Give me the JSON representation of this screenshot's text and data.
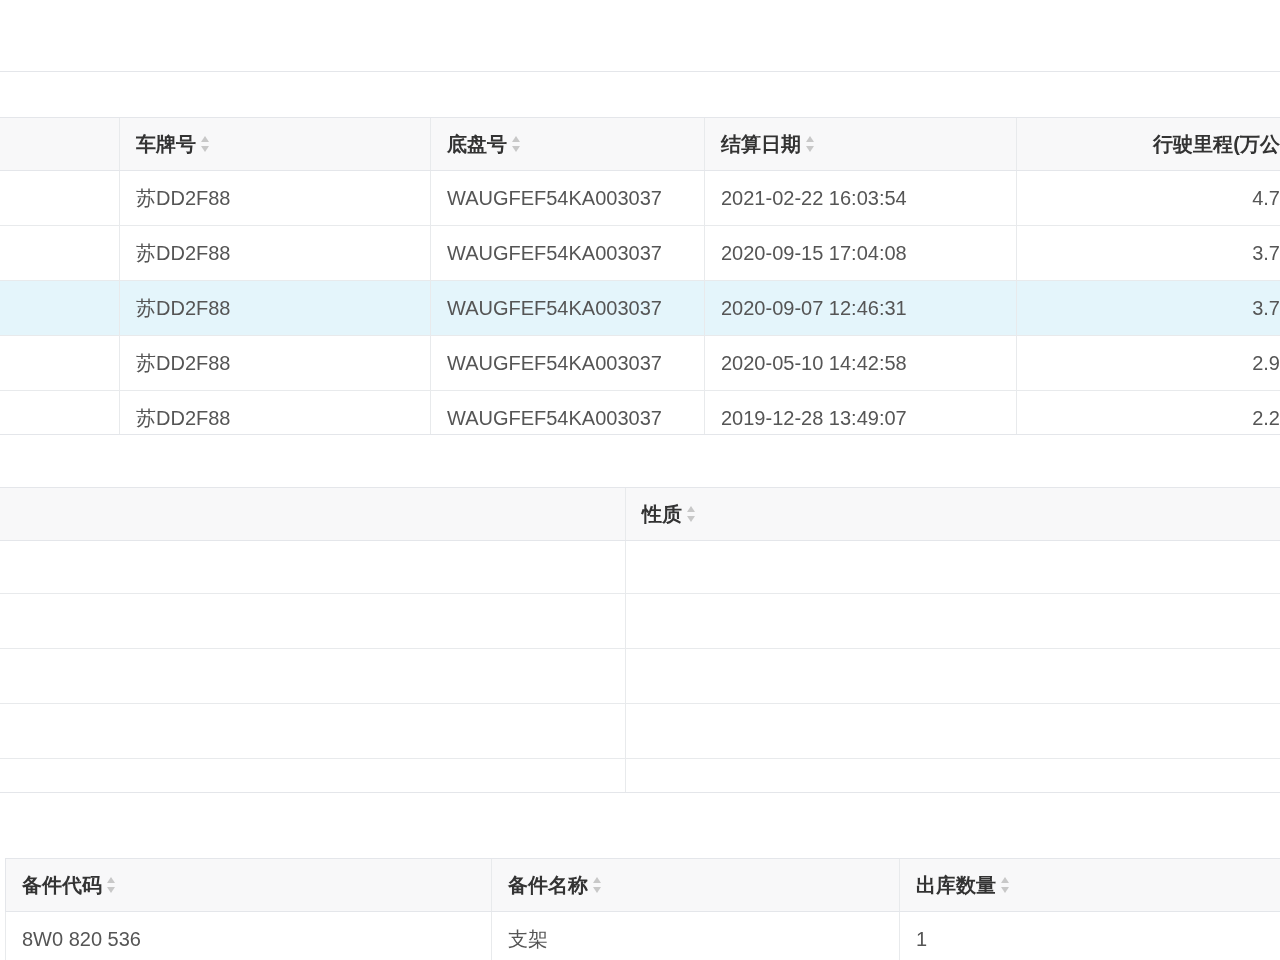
{
  "settlement_table": {
    "columns": [
      {
        "label": "车牌号",
        "sortable": true
      },
      {
        "label": "底盘号",
        "sortable": true
      },
      {
        "label": "结算日期",
        "sortable": true
      },
      {
        "label": "行驶里程(万公",
        "sortable": false
      }
    ],
    "rows": [
      {
        "selected": false,
        "cells": [
          "苏DD2F88",
          "WAUGFEF54KA003037",
          "2021-02-22 16:03:54",
          "4.7"
        ]
      },
      {
        "selected": false,
        "cells": [
          "苏DD2F88",
          "WAUGFEF54KA003037",
          "2020-09-15 17:04:08",
          "3.7"
        ]
      },
      {
        "selected": true,
        "cells": [
          "苏DD2F88",
          "WAUGFEF54KA003037",
          "2020-09-07 12:46:31",
          "3.7"
        ]
      },
      {
        "selected": false,
        "cells": [
          "苏DD2F88",
          "WAUGFEF54KA003037",
          "2020-05-10 14:42:58",
          "2.9"
        ]
      },
      {
        "selected": false,
        "cells": [
          "苏DD2F88",
          "WAUGFEF54KA003037",
          "2019-12-28 13:49:07",
          "2.2"
        ]
      }
    ]
  },
  "nature_table": {
    "columns": [
      {
        "label": "性质",
        "sortable": true
      }
    ]
  },
  "parts_table": {
    "columns": [
      {
        "label": "备件代码",
        "sortable": true
      },
      {
        "label": "备件名称",
        "sortable": true
      },
      {
        "label": "出库数量",
        "sortable": true
      }
    ],
    "rows": [
      {
        "cells": [
          "8W0 820 536",
          "支架",
          "1"
        ]
      }
    ]
  }
}
